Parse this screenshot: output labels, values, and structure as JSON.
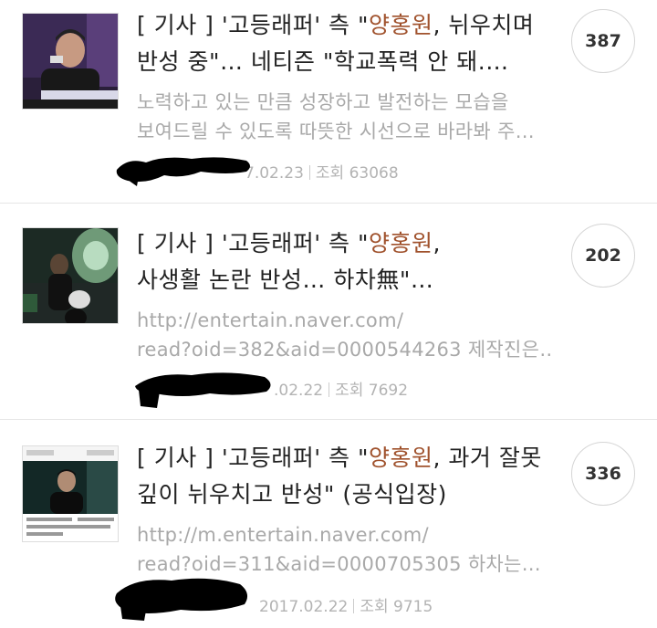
{
  "posts": [
    {
      "tag": "[ 기사 ]",
      "title_pre": "'고등래퍼' 측 \"",
      "title_highlight": "양홍원",
      "title_post_line1": ", 뉘우치며",
      "title_line2": "반성 중\"… 네티즌 \"학교폭력 안 돼.…",
      "preview_line1": "노력하고 있는 만큼 성장하고 발전하는 모습을",
      "preview_line2": "보여드릴 수 있도록 따뜻한 시선으로 바라봐 주…",
      "date": "7.02.23",
      "views": "조회 63068",
      "comment_count": "387",
      "thumb_icon": "news-thumbnail-rapper"
    },
    {
      "tag": "[ 기사 ]",
      "title_pre": "'고등래퍼' 측 \"",
      "title_highlight": "양홍원",
      "title_post_line1": ",",
      "title_line2": "사생활 논란 반성… 하차無\"…",
      "preview_line1": "http://entertain.naver.com/",
      "preview_line2": "read?oid=382&aid=0000544263 제작진은…",
      "date": ".02.22",
      "views": "조회 7692",
      "comment_count": "202",
      "thumb_icon": "news-thumbnail-stage"
    },
    {
      "tag": "[ 기사 ]",
      "title_pre": "'고등래퍼' 측 \"",
      "title_highlight": "양홍원",
      "title_post_line1": ", 과거 잘못",
      "title_line2": "깊이 뉘우치고 반성\" (공식입장)",
      "preview_line1": "http://m.entertain.naver.com/",
      "preview_line2": "read?oid=311&aid=0000705305 하차는…",
      "date": "2017.02.22",
      "views": "조회 9715",
      "comment_count": "336",
      "thumb_icon": "news-thumbnail-broadcast"
    }
  ],
  "colors": {
    "highlight": "#a0522d",
    "preview_text": "#a9a9a9",
    "meta_text": "#b3b3b3"
  }
}
